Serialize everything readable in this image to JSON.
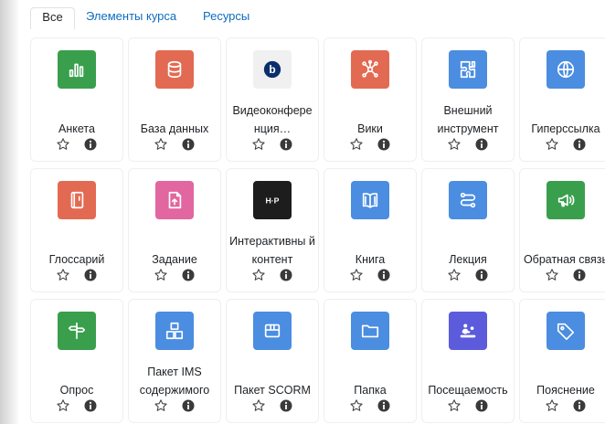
{
  "tabs": {
    "all": "Все",
    "activities": "Элементы курса",
    "resources": "Ресурсы"
  },
  "activities": [
    {
      "label": "Анкета",
      "icon": "chart-icon",
      "color": "#399f4d"
    },
    {
      "label": "База данных",
      "icon": "database-icon",
      "color": "#e36a52"
    },
    {
      "label": "Видеоконфере нция…",
      "icon": "bigbluebutton-icon",
      "color": "#ffffff"
    },
    {
      "label": "Вики",
      "icon": "wiki-network-icon",
      "color": "#e36a52"
    },
    {
      "label": "Внешний инструмент",
      "icon": "puzzle-icon",
      "color": "#4b8de0"
    },
    {
      "label": "Гиперссылка",
      "icon": "globe-icon",
      "color": "#4b8de0"
    },
    {
      "label": "Глоссарий",
      "icon": "notebook-icon",
      "color": "#e36a52"
    },
    {
      "label": "Задание",
      "icon": "file-upload-icon",
      "color": "#e2669f"
    },
    {
      "label": "Интерактивны й контент",
      "icon": "h5p-icon",
      "color": "#1d1d1d"
    },
    {
      "label": "Книга",
      "icon": "book-icon",
      "color": "#4b8de0"
    },
    {
      "label": "Лекция",
      "icon": "path-icon",
      "color": "#4b8de0"
    },
    {
      "label": "Обратная связь",
      "icon": "megaphone-icon",
      "color": "#399f4d"
    },
    {
      "label": "Опрос",
      "icon": "signpost-icon",
      "color": "#399f4d"
    },
    {
      "label": "Пакет IMS содержимого",
      "icon": "boxes-icon",
      "color": "#4b8de0"
    },
    {
      "label": "Пакет SCORM",
      "icon": "package-icon",
      "color": "#4b8de0"
    },
    {
      "label": "Папка",
      "icon": "folder-icon",
      "color": "#4b8de0"
    },
    {
      "label": "Посещаемость",
      "icon": "attendance-icon",
      "color": "#5b5bdc"
    },
    {
      "label": "Пояснение",
      "icon": "tag-icon",
      "color": "#4b8de0"
    }
  ]
}
